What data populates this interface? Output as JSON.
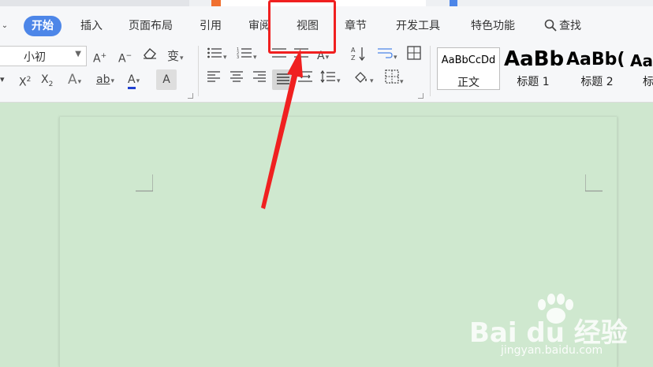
{
  "tabs": [
    {
      "label": "开始",
      "active": true
    },
    {
      "label": "插入"
    },
    {
      "label": "页面布局"
    },
    {
      "label": "引用"
    },
    {
      "label": "审阅"
    },
    {
      "label": "视图"
    },
    {
      "label": "章节"
    },
    {
      "label": "开发工具"
    },
    {
      "label": "特色功能"
    },
    {
      "label": "查找"
    }
  ],
  "font_size": {
    "value": "小初"
  },
  "toolbar": {
    "grow_font": "A⁺",
    "shrink_font": "A⁻",
    "clear_format": "⌫",
    "pinyin": "变",
    "superscript": "X²",
    "subscript": "X₂",
    "text_effect": "A",
    "highlight": "ab",
    "font_color": "A",
    "char_shading": "A"
  },
  "styles": [
    {
      "preview": "AaBbCcDd",
      "name": "正文"
    },
    {
      "preview": "AaBb",
      "name": "标题 1"
    },
    {
      "preview": "AaBb(",
      "name": "标题 2"
    },
    {
      "preview": "AaB",
      "name": "标"
    }
  ],
  "watermark": {
    "main": "Bai du 经验",
    "url": "jingyan.baidu.com"
  },
  "colors": {
    "active_tab": "#4d86e8",
    "annotation": "#f02020",
    "page": "#cfe8cf"
  }
}
